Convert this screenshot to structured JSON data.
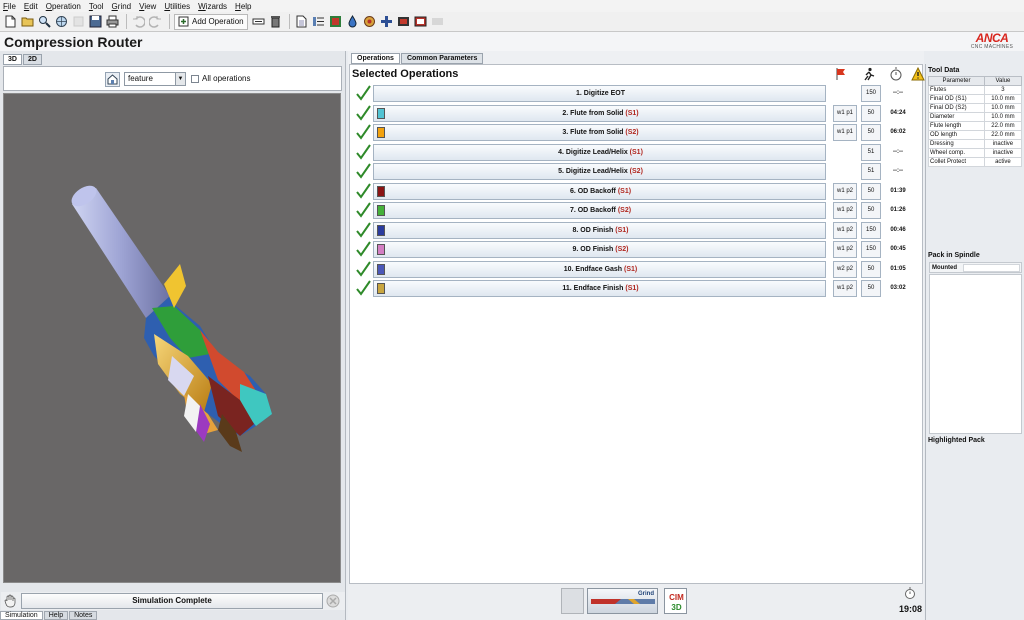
{
  "menu": [
    "File",
    "Edit",
    "Operation",
    "Tool",
    "Grind",
    "View",
    "Utilities",
    "Wizards",
    "Help"
  ],
  "toolbar": {
    "add_operation_label": "Add Operation",
    "icons": [
      "new-file-icon",
      "open-icon",
      "search-icon",
      "globe-icon",
      "blank-icon",
      "save-icon",
      "print-icon",
      "undo-icon",
      "redo-icon",
      "add-operation-icon",
      "sequence-icon",
      "delete-icon",
      "document-icon",
      "list-icon",
      "layers-icon",
      "droplet-icon",
      "wheel-icon",
      "plus-icon",
      "machine-icon",
      "camera-icon",
      "grind-icon"
    ]
  },
  "app": {
    "title": "Compression Router",
    "logo": "ANCA",
    "logo_sub": "CNC MACHINES"
  },
  "left_panel": {
    "view_tabs": [
      "3D",
      "2D"
    ],
    "feature_select": "feature",
    "all_operations_label": "All operations",
    "simulation_status": "Simulation Complete",
    "bottom_tabs": [
      "Simulation",
      "Help",
      "Notes"
    ]
  },
  "center": {
    "tabs": [
      "Operations",
      "Common Parameters"
    ],
    "heading": "Selected Operations",
    "operations": [
      {
        "name": "1. Digitize EOT",
        "side": "",
        "color": "",
        "wheel": "",
        "num": "150",
        "time": "--:--"
      },
      {
        "name": "2. Flute from Solid",
        "side": "(S1)",
        "color": "#52c3d3",
        "wheel": "w1 p1",
        "num": "50",
        "time": "04:24"
      },
      {
        "name": "3. Flute from Solid",
        "side": "(S2)",
        "color": "#f2a20f",
        "wheel": "w1 p1",
        "num": "50",
        "time": "06:02"
      },
      {
        "name": "4. Digitize Lead/Helix",
        "side": "(S1)",
        "color": "",
        "wheel": "",
        "num": "51",
        "time": "--:--"
      },
      {
        "name": "5. Digitize Lead/Helix",
        "side": "(S2)",
        "color": "",
        "wheel": "",
        "num": "51",
        "time": "--:--"
      },
      {
        "name": "6. OD Backoff",
        "side": "(S1)",
        "color": "#8a1414",
        "wheel": "w1 p2",
        "num": "50",
        "time": "01:39"
      },
      {
        "name": "7. OD Backoff",
        "side": "(S2)",
        "color": "#45b13a",
        "wheel": "w1 p2",
        "num": "50",
        "time": "01:26"
      },
      {
        "name": "8. OD Finish",
        "side": "(S1)",
        "color": "#2b3c9e",
        "wheel": "w1 p2",
        "num": "150",
        "time": "00:46"
      },
      {
        "name": "9. OD Finish",
        "side": "(S2)",
        "color": "#d37ec2",
        "wheel": "w1 p2",
        "num": "150",
        "time": "00:45"
      },
      {
        "name": "10. Endface Gash",
        "side": "(S1)",
        "color": "#4c58b8",
        "wheel": "w2 p2",
        "num": "50",
        "time": "01:05"
      },
      {
        "name": "11. Endface Finish",
        "side": "(S1)",
        "color": "#c9a640",
        "wheel": "w1 p2",
        "num": "50",
        "time": "03:02"
      }
    ],
    "grind_thumb_label": "Grind",
    "cim3d_label": "CIM 3D",
    "clock_time": "19:08"
  },
  "tool_data": {
    "title": "Tool Data",
    "headers": [
      "Parameter",
      "Value"
    ],
    "rows": [
      [
        "Flutes",
        "3"
      ],
      [
        "Final OD (S1)",
        "10.0 mm"
      ],
      [
        "Final OD (S2)",
        "10.0 mm"
      ],
      [
        "Diameter",
        "10.0 mm"
      ],
      [
        "Flute length",
        "22.0 mm"
      ],
      [
        "OD length",
        "22.0 mm"
      ],
      [
        "Dressing",
        "inactive"
      ],
      [
        "Wheel comp.",
        "inactive"
      ],
      [
        "Collet Protect",
        "active"
      ]
    ],
    "pack_title": "Pack in Spindle",
    "mounted_label": "Mounted",
    "highlighted_title": "Highlighted Pack"
  },
  "colors": {
    "accent_red": "#b0261e",
    "check_green": "#2f8a2a",
    "viewport_bg": "#696767"
  }
}
